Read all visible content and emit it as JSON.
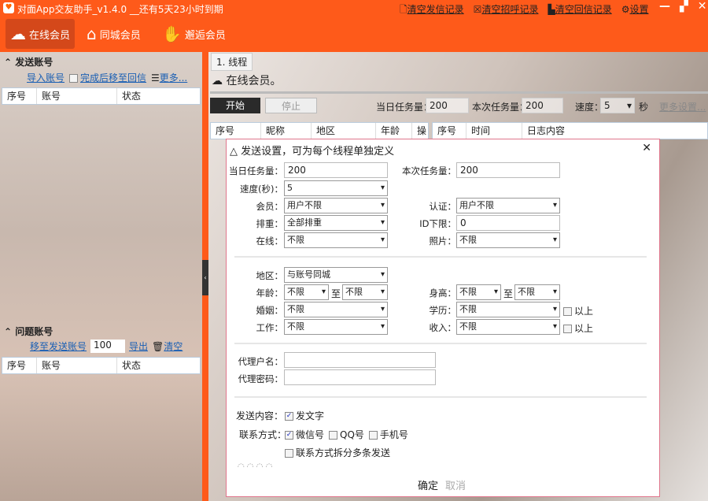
{
  "window": {
    "title": "对面App交友助手_v1.4.0 __还有5天23小时到期",
    "links": [
      "清空发信记录",
      "清空招呼记录",
      "清空回信记录",
      "设置"
    ]
  },
  "nav": [
    {
      "label": "在线会员",
      "icon": "cloud-upload-icon"
    },
    {
      "label": "同城会员",
      "icon": "home-icon"
    },
    {
      "label": "邂逅会员",
      "icon": "handshake-icon"
    }
  ],
  "left": {
    "send": {
      "title": "发送账号",
      "import": "导入账号",
      "move_after": "完成后移至回信",
      "more": "更多...",
      "columns": [
        "序号",
        "账号",
        "状态"
      ]
    },
    "problem": {
      "title": "问题账号",
      "move": "移至发送账号",
      "count": "100",
      "export": "导出",
      "clear": "清空",
      "columns": [
        "序号",
        "账号",
        "状态"
      ]
    }
  },
  "main": {
    "tab": "1. 线程",
    "heading": "在线会员。",
    "start": "开始",
    "stop": "停止",
    "daily_label": "当日任务量：",
    "daily": "200",
    "this_label": "本次任务量：",
    "this": "200",
    "speed_label": "速度：",
    "speed": "5",
    "sec": "秒",
    "more": "更多设置...",
    "member_cols": [
      "序号",
      "昵称",
      "地区",
      "年龄",
      "操"
    ],
    "log_cols": [
      "序号",
      "时间",
      "日志内容"
    ]
  },
  "dialog": {
    "title": "发送设置，可为每个线程单独定义",
    "daily_label": "当日任务量：",
    "daily": "200",
    "this_label": "本次任务量：",
    "this": "200",
    "speed_label": "速度(秒)：",
    "speed": "5",
    "member_label": "会员：",
    "member": "用户不限",
    "auth_label": "认证：",
    "auth": "用户不限",
    "dedup_label": "排重：",
    "dedup": "全部排重",
    "idmin_label": "ID下限：",
    "idmin": "0",
    "online_label": "在线：",
    "online": "不限",
    "photo_label": "照片：",
    "photo": "不限",
    "region_label": "地区：",
    "region": "与账号同城",
    "age_label": "年龄：",
    "age_from": "不限",
    "to": "至",
    "age_to": "不限",
    "height_label": "身高：",
    "height_from": "不限",
    "height_to": "不限",
    "marriage_label": "婚姻：",
    "marriage": "不限",
    "edu_label": "学历：",
    "edu": "不限",
    "above": "以上",
    "job_label": "工作：",
    "job": "不限",
    "income_label": "收入：",
    "income": "不限",
    "proxy_user_label": "代理户名：",
    "proxy_pass_label": "代理密码：",
    "content_label": "发送内容：",
    "text_opt": "发文字",
    "contact_label": "联系方式：",
    "wechat": "微信号",
    "qq": "QQ号",
    "phone": "手机号",
    "split": "联系方式拆分多条发送",
    "ok": "确定",
    "cancel": "取消"
  }
}
